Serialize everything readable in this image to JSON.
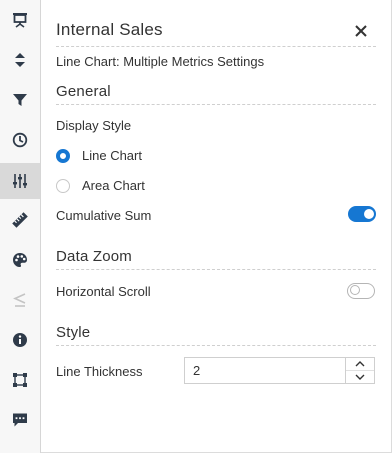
{
  "panel": {
    "title": "Internal Sales",
    "subtitle": "Line Chart: Multiple Metrics Settings"
  },
  "sections": {
    "general": {
      "title": "General",
      "display_style_label": "Display Style",
      "options": [
        "Line Chart",
        "Area Chart"
      ],
      "selected": "Line Chart",
      "cumulative_sum_label": "Cumulative Sum",
      "cumulative_sum_on": true
    },
    "data_zoom": {
      "title": "Data Zoom",
      "horizontal_scroll_label": "Horizontal Scroll",
      "horizontal_scroll_on": false
    },
    "style": {
      "title": "Style",
      "line_thickness_label": "Line Thickness",
      "line_thickness_value": "2"
    }
  },
  "rail": {
    "icons": [
      "presentation-icon",
      "sort-icon",
      "filter-icon",
      "clock-icon",
      "sliders-icon",
      "ruler-icon",
      "palette-icon",
      "less-equal-icon",
      "info-icon",
      "selection-icon",
      "comment-icon"
    ],
    "active": "sliders-icon"
  },
  "colors": {
    "accent": "#1677d2",
    "icon": "#2f3b4a",
    "muted_icon": "#c4c4c4",
    "rail_bg": "#f7f7f7",
    "rail_active": "#d9d9d9"
  }
}
